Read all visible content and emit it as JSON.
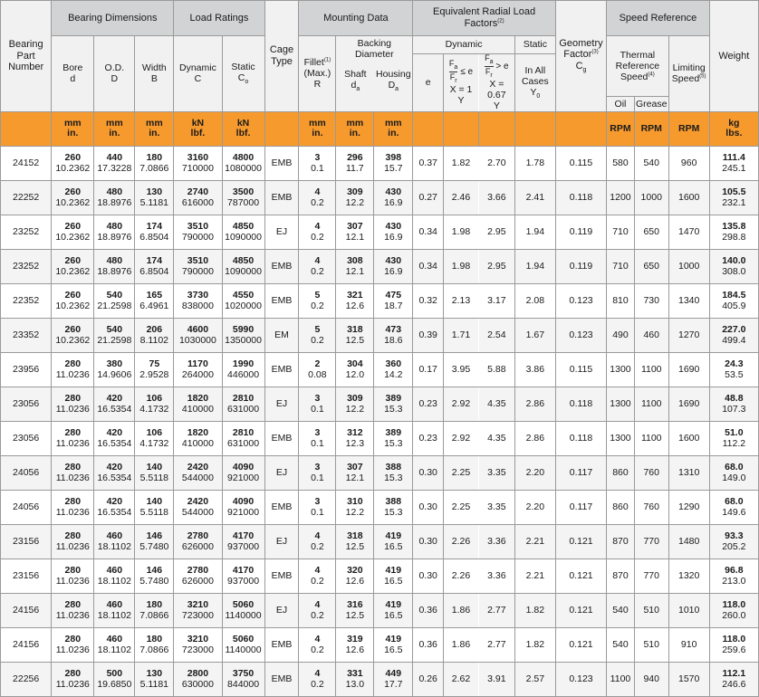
{
  "headers": {
    "part": "Bearing Part Number",
    "bearing_dimensions": "Bearing Dimensions",
    "bore": "Bore",
    "bore_sym": "d",
    "od": "O.D.",
    "od_sym": "D",
    "width": "Width",
    "width_sym": "B",
    "load_ratings": "Load Ratings",
    "dynamic": "Dynamic",
    "dynamic_sym": "C",
    "static": "Static",
    "static_sym": "C",
    "static_sub": "o",
    "cage_type": "Cage Type",
    "mounting_data": "Mounting Data",
    "fillet": "Fillet",
    "fillet_note": "(1)",
    "fillet_max": "(Max.)",
    "fillet_sym": "R",
    "backing_diameter": "Backing Diameter",
    "shaft": "Shaft",
    "shaft_sym": "d",
    "shaft_sub": "a",
    "housing": "Housing",
    "housing_sym": "D",
    "housing_sub": "a",
    "equivalent": "Equivalent Radial Load Factors",
    "equivalent_note": "(2)",
    "eq_dynamic": "Dynamic",
    "eq_static": "Static",
    "e_sym": "e",
    "le_rel": "≤ e",
    "gt_rel": "> e",
    "fa": "F",
    "fa_sub": "a",
    "fr": "F",
    "fr_sub": "r",
    "x1": "X = 1",
    "x067": "X = 0.67",
    "y_sym": "Y",
    "in_all_cases": "In All Cases",
    "y0": "Y",
    "y0_sub": "0",
    "geometry": "Geometry Factor",
    "geometry_note": "(3)",
    "cg": "C",
    "cg_sub": "g",
    "speed_reference": "Speed Reference",
    "thermal": "Thermal Reference Speed",
    "thermal_note": "(4)",
    "limiting": "Limiting Speed",
    "limiting_note": "(5)",
    "oil": "Oil",
    "grease": "Grease",
    "weight": "Weight"
  },
  "units": {
    "mm": "mm",
    "in": "in.",
    "kn": "kN",
    "lbf": "lbf.",
    "rpm": "RPM",
    "kg": "kg",
    "lbs": "lbs."
  },
  "rows": [
    {
      "part": "24152",
      "bore": "260",
      "bore_in": "10.2362",
      "od": "440",
      "od_in": "17.3228",
      "width": "180",
      "width_in": "7.0866",
      "dyn_kn": "3160",
      "dyn_lbf": "710000",
      "sta_kn": "4800",
      "sta_lbf": "1080000",
      "cage": "EMB",
      "r_mm": "3",
      "r_in": "0.1",
      "shaft_mm": "296",
      "shaft_in": "11.7",
      "housing_mm": "398",
      "housing_in": "15.7",
      "e": "0.37",
      "y1": "1.82",
      "y2": "2.70",
      "y0": "1.78",
      "cg": "0.115",
      "oil": "580",
      "grease": "540",
      "limit": "960",
      "kg": "111.4",
      "lbs": "245.1"
    },
    {
      "part": "22252",
      "bore": "260",
      "bore_in": "10.2362",
      "od": "480",
      "od_in": "18.8976",
      "width": "130",
      "width_in": "5.1181",
      "dyn_kn": "2740",
      "dyn_lbf": "616000",
      "sta_kn": "3500",
      "sta_lbf": "787000",
      "cage": "EMB",
      "r_mm": "4",
      "r_in": "0.2",
      "shaft_mm": "309",
      "shaft_in": "12.2",
      "housing_mm": "430",
      "housing_in": "16.9",
      "e": "0.27",
      "y1": "2.46",
      "y2": "3.66",
      "y0": "2.41",
      "cg": "0.118",
      "oil": "1200",
      "grease": "1000",
      "limit": "1600",
      "kg": "105.5",
      "lbs": "232.1"
    },
    {
      "part": "23252",
      "bore": "260",
      "bore_in": "10.2362",
      "od": "480",
      "od_in": "18.8976",
      "width": "174",
      "width_in": "6.8504",
      "dyn_kn": "3510",
      "dyn_lbf": "790000",
      "sta_kn": "4850",
      "sta_lbf": "1090000",
      "cage": "EJ",
      "r_mm": "4",
      "r_in": "0.2",
      "shaft_mm": "307",
      "shaft_in": "12.1",
      "housing_mm": "430",
      "housing_in": "16.9",
      "e": "0.34",
      "y1": "1.98",
      "y2": "2.95",
      "y0": "1.94",
      "cg": "0.119",
      "oil": "710",
      "grease": "650",
      "limit": "1470",
      "kg": "135.8",
      "lbs": "298.8"
    },
    {
      "part": "23252",
      "bore": "260",
      "bore_in": "10.2362",
      "od": "480",
      "od_in": "18.8976",
      "width": "174",
      "width_in": "6.8504",
      "dyn_kn": "3510",
      "dyn_lbf": "790000",
      "sta_kn": "4850",
      "sta_lbf": "1090000",
      "cage": "EMB",
      "r_mm": "4",
      "r_in": "0.2",
      "shaft_mm": "308",
      "shaft_in": "12.1",
      "housing_mm": "430",
      "housing_in": "16.9",
      "e": "0.34",
      "y1": "1.98",
      "y2": "2.95",
      "y0": "1.94",
      "cg": "0.119",
      "oil": "710",
      "grease": "650",
      "limit": "1000",
      "kg": "140.0",
      "lbs": "308.0"
    },
    {
      "part": "22352",
      "bore": "260",
      "bore_in": "10.2362",
      "od": "540",
      "od_in": "21.2598",
      "width": "165",
      "width_in": "6.4961",
      "dyn_kn": "3730",
      "dyn_lbf": "838000",
      "sta_kn": "4550",
      "sta_lbf": "1020000",
      "cage": "EMB",
      "r_mm": "5",
      "r_in": "0.2",
      "shaft_mm": "321",
      "shaft_in": "12.6",
      "housing_mm": "475",
      "housing_in": "18.7",
      "e": "0.32",
      "y1": "2.13",
      "y2": "3.17",
      "y0": "2.08",
      "cg": "0.123",
      "oil": "810",
      "grease": "730",
      "limit": "1340",
      "kg": "184.5",
      "lbs": "405.9"
    },
    {
      "part": "23352",
      "bore": "260",
      "bore_in": "10.2362",
      "od": "540",
      "od_in": "21.2598",
      "width": "206",
      "width_in": "8.1102",
      "dyn_kn": "4600",
      "dyn_lbf": "1030000",
      "sta_kn": "5990",
      "sta_lbf": "1350000",
      "cage": "EM",
      "r_mm": "5",
      "r_in": "0.2",
      "shaft_mm": "318",
      "shaft_in": "12.5",
      "housing_mm": "473",
      "housing_in": "18.6",
      "e": "0.39",
      "y1": "1.71",
      "y2": "2.54",
      "y0": "1.67",
      "cg": "0.123",
      "oil": "490",
      "grease": "460",
      "limit": "1270",
      "kg": "227.0",
      "lbs": "499.4"
    },
    {
      "part": "23956",
      "bore": "280",
      "bore_in": "11.0236",
      "od": "380",
      "od_in": "14.9606",
      "width": "75",
      "width_in": "2.9528",
      "dyn_kn": "1170",
      "dyn_lbf": "264000",
      "sta_kn": "1990",
      "sta_lbf": "446000",
      "cage": "EMB",
      "r_mm": "2",
      "r_in": "0.08",
      "shaft_mm": "304",
      "shaft_in": "12.0",
      "housing_mm": "360",
      "housing_in": "14.2",
      "e": "0.17",
      "y1": "3.95",
      "y2": "5.88",
      "y0": "3.86",
      "cg": "0.115",
      "oil": "1300",
      "grease": "1100",
      "limit": "1690",
      "kg": "24.3",
      "lbs": "53.5"
    },
    {
      "part": "23056",
      "bore": "280",
      "bore_in": "11.0236",
      "od": "420",
      "od_in": "16.5354",
      "width": "106",
      "width_in": "4.1732",
      "dyn_kn": "1820",
      "dyn_lbf": "410000",
      "sta_kn": "2810",
      "sta_lbf": "631000",
      "cage": "EJ",
      "r_mm": "3",
      "r_in": "0.1",
      "shaft_mm": "309",
      "shaft_in": "12.2",
      "housing_mm": "389",
      "housing_in": "15.3",
      "e": "0.23",
      "y1": "2.92",
      "y2": "4.35",
      "y0": "2.86",
      "cg": "0.118",
      "oil": "1300",
      "grease": "1100",
      "limit": "1690",
      "kg": "48.8",
      "lbs": "107.3"
    },
    {
      "part": "23056",
      "bore": "280",
      "bore_in": "11.0236",
      "od": "420",
      "od_in": "16.5354",
      "width": "106",
      "width_in": "4.1732",
      "dyn_kn": "1820",
      "dyn_lbf": "410000",
      "sta_kn": "2810",
      "sta_lbf": "631000",
      "cage": "EMB",
      "r_mm": "3",
      "r_in": "0.1",
      "shaft_mm": "312",
      "shaft_in": "12.3",
      "housing_mm": "389",
      "housing_in": "15.3",
      "e": "0.23",
      "y1": "2.92",
      "y2": "4.35",
      "y0": "2.86",
      "cg": "0.118",
      "oil": "1300",
      "grease": "1100",
      "limit": "1600",
      "kg": "51.0",
      "lbs": "112.2"
    },
    {
      "part": "24056",
      "bore": "280",
      "bore_in": "11.0236",
      "od": "420",
      "od_in": "16.5354",
      "width": "140",
      "width_in": "5.5118",
      "dyn_kn": "2420",
      "dyn_lbf": "544000",
      "sta_kn": "4090",
      "sta_lbf": "921000",
      "cage": "EJ",
      "r_mm": "3",
      "r_in": "0.1",
      "shaft_mm": "307",
      "shaft_in": "12.1",
      "housing_mm": "388",
      "housing_in": "15.3",
      "e": "0.30",
      "y1": "2.25",
      "y2": "3.35",
      "y0": "2.20",
      "cg": "0.117",
      "oil": "860",
      "grease": "760",
      "limit": "1310",
      "kg": "68.0",
      "lbs": "149.0"
    },
    {
      "part": "24056",
      "bore": "280",
      "bore_in": "11.0236",
      "od": "420",
      "od_in": "16.5354",
      "width": "140",
      "width_in": "5.5118",
      "dyn_kn": "2420",
      "dyn_lbf": "544000",
      "sta_kn": "4090",
      "sta_lbf": "921000",
      "cage": "EMB",
      "r_mm": "3",
      "r_in": "0.1",
      "shaft_mm": "310",
      "shaft_in": "12.2",
      "housing_mm": "388",
      "housing_in": "15.3",
      "e": "0.30",
      "y1": "2.25",
      "y2": "3.35",
      "y0": "2.20",
      "cg": "0.117",
      "oil": "860",
      "grease": "760",
      "limit": "1290",
      "kg": "68.0",
      "lbs": "149.6"
    },
    {
      "part": "23156",
      "bore": "280",
      "bore_in": "11.0236",
      "od": "460",
      "od_in": "18.1102",
      "width": "146",
      "width_in": "5.7480",
      "dyn_kn": "2780",
      "dyn_lbf": "626000",
      "sta_kn": "4170",
      "sta_lbf": "937000",
      "cage": "EJ",
      "r_mm": "4",
      "r_in": "0.2",
      "shaft_mm": "318",
      "shaft_in": "12.5",
      "housing_mm": "419",
      "housing_in": "16.5",
      "e": "0.30",
      "y1": "2.26",
      "y2": "3.36",
      "y0": "2.21",
      "cg": "0.121",
      "oil": "870",
      "grease": "770",
      "limit": "1480",
      "kg": "93.3",
      "lbs": "205.2"
    },
    {
      "part": "23156",
      "bore": "280",
      "bore_in": "11.0236",
      "od": "460",
      "od_in": "18.1102",
      "width": "146",
      "width_in": "5.7480",
      "dyn_kn": "2780",
      "dyn_lbf": "626000",
      "sta_kn": "4170",
      "sta_lbf": "937000",
      "cage": "EMB",
      "r_mm": "4",
      "r_in": "0.2",
      "shaft_mm": "320",
      "shaft_in": "12.6",
      "housing_mm": "419",
      "housing_in": "16.5",
      "e": "0.30",
      "y1": "2.26",
      "y2": "3.36",
      "y0": "2.21",
      "cg": "0.121",
      "oil": "870",
      "grease": "770",
      "limit": "1320",
      "kg": "96.8",
      "lbs": "213.0"
    },
    {
      "part": "24156",
      "bore": "280",
      "bore_in": "11.0236",
      "od": "460",
      "od_in": "18.1102",
      "width": "180",
      "width_in": "7.0866",
      "dyn_kn": "3210",
      "dyn_lbf": "723000",
      "sta_kn": "5060",
      "sta_lbf": "1140000",
      "cage": "EJ",
      "r_mm": "4",
      "r_in": "0.2",
      "shaft_mm": "316",
      "shaft_in": "12.5",
      "housing_mm": "419",
      "housing_in": "16.5",
      "e": "0.36",
      "y1": "1.86",
      "y2": "2.77",
      "y0": "1.82",
      "cg": "0.121",
      "oil": "540",
      "grease": "510",
      "limit": "1010",
      "kg": "118.0",
      "lbs": "260.0"
    },
    {
      "part": "24156",
      "bore": "280",
      "bore_in": "11.0236",
      "od": "460",
      "od_in": "18.1102",
      "width": "180",
      "width_in": "7.0866",
      "dyn_kn": "3210",
      "dyn_lbf": "723000",
      "sta_kn": "5060",
      "sta_lbf": "1140000",
      "cage": "EMB",
      "r_mm": "4",
      "r_in": "0.2",
      "shaft_mm": "319",
      "shaft_in": "12.6",
      "housing_mm": "419",
      "housing_in": "16.5",
      "e": "0.36",
      "y1": "1.86",
      "y2": "2.77",
      "y0": "1.82",
      "cg": "0.121",
      "oil": "540",
      "grease": "510",
      "limit": "910",
      "kg": "118.0",
      "lbs": "259.6"
    },
    {
      "part": "22256",
      "bore": "280",
      "bore_in": "11.0236",
      "od": "500",
      "od_in": "19.6850",
      "width": "130",
      "width_in": "5.1181",
      "dyn_kn": "2800",
      "dyn_lbf": "630000",
      "sta_kn": "3750",
      "sta_lbf": "844000",
      "cage": "EMB",
      "r_mm": "4",
      "r_in": "0.2",
      "shaft_mm": "331",
      "shaft_in": "13.0",
      "housing_mm": "449",
      "housing_in": "17.7",
      "e": "0.26",
      "y1": "2.62",
      "y2": "3.91",
      "y0": "2.57",
      "cg": "0.123",
      "oil": "1100",
      "grease": "940",
      "limit": "1570",
      "kg": "112.1",
      "lbs": "246.6"
    }
  ]
}
